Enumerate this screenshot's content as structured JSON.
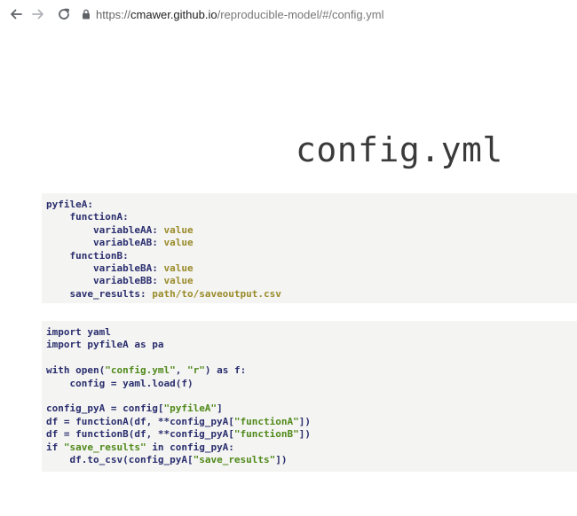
{
  "browser": {
    "url_scheme": "https://",
    "url_host": "cmawer.github.io",
    "url_path": "/reproducible-model/#/config.yml"
  },
  "page": {
    "title": "config.yml"
  },
  "yaml_block": {
    "lines": [
      {
        "key": "pyfileA:",
        "value": ""
      },
      {
        "key": "    functionA:",
        "value": ""
      },
      {
        "key": "        variableAA:",
        "value": " value"
      },
      {
        "key": "        variableAB:",
        "value": " value"
      },
      {
        "key": "    functionB:",
        "value": ""
      },
      {
        "key": "        variableBA:",
        "value": " value"
      },
      {
        "key": "        variableBB:",
        "value": " value"
      },
      {
        "key": "    save_results:",
        "value": " path/to/saveoutput.csv"
      }
    ]
  },
  "python_block": {
    "lines": [
      [
        {
          "t": "import yaml",
          "c": "k"
        }
      ],
      [
        {
          "t": "import pyfileA as pa",
          "c": "k"
        }
      ],
      [
        {
          "t": "",
          "c": "k"
        }
      ],
      [
        {
          "t": "with open(",
          "c": "k"
        },
        {
          "t": "\"config.yml\"",
          "c": "s"
        },
        {
          "t": ", ",
          "c": "k"
        },
        {
          "t": "\"r\"",
          "c": "s"
        },
        {
          "t": ") as f:",
          "c": "k"
        }
      ],
      [
        {
          "t": "    config = yaml.load(f)",
          "c": "k"
        }
      ],
      [
        {
          "t": "",
          "c": "k"
        }
      ],
      [
        {
          "t": "config_pyA = config[",
          "c": "k"
        },
        {
          "t": "\"pyfileA\"",
          "c": "s"
        },
        {
          "t": "]",
          "c": "k"
        }
      ],
      [
        {
          "t": "df = functionA(df, **config_pyA[",
          "c": "k"
        },
        {
          "t": "\"functionA\"",
          "c": "s"
        },
        {
          "t": "])",
          "c": "k"
        }
      ],
      [
        {
          "t": "df = functionB(df, **config_pyA[",
          "c": "k"
        },
        {
          "t": "\"functionB\"",
          "c": "s"
        },
        {
          "t": "])",
          "c": "k"
        }
      ],
      [
        {
          "t": "if ",
          "c": "k"
        },
        {
          "t": "\"save_results\"",
          "c": "s"
        },
        {
          "t": " in config_pyA:",
          "c": "k"
        }
      ],
      [
        {
          "t": "    df.to_csv(config_pyA[",
          "c": "k"
        },
        {
          "t": "\"save_results\"",
          "c": "s"
        },
        {
          "t": "])",
          "c": "k"
        }
      ]
    ]
  },
  "colors": {
    "code_background": "#f4f4f2",
    "yaml_value": "#9a8b2a",
    "string": "#50891a",
    "keyword": "#2a2e6e"
  },
  "icons": [
    "back-arrow-icon",
    "forward-arrow-icon",
    "reload-icon",
    "lock-icon"
  ]
}
